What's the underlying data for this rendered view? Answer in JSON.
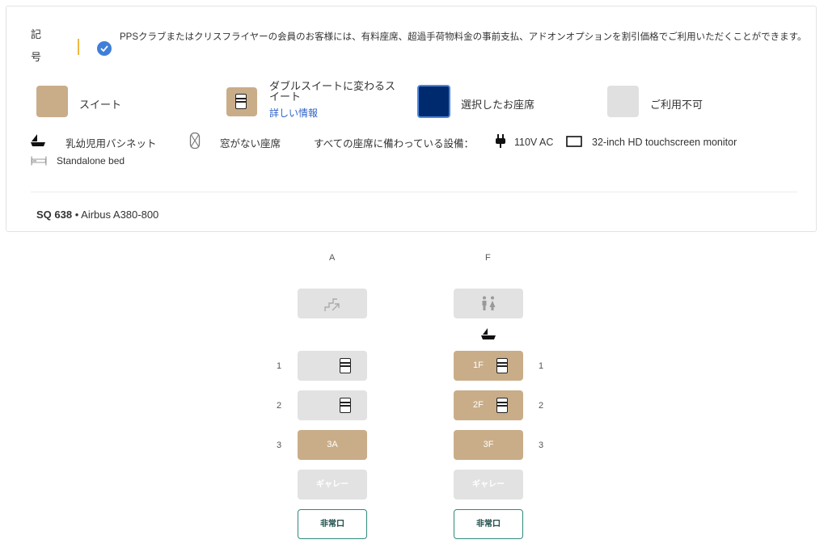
{
  "legend": {
    "key_label_line1": "記",
    "key_label_line2": "号",
    "note": "PPSクラブまたはクリスフライヤーの会員のお客様には、有料座席、超過手荷物料金の事前支払、アドオンオプションを割引価格でご利用いただくことができます。",
    "suite_label": "スイート",
    "double_suite_label": "ダブルスイートに変わるスイート",
    "double_suite_link": "詳しい情報",
    "selected_label": "選択したお座席",
    "unavailable_label": "ご利用不可",
    "bassinet_label": "乳幼児用バシネット",
    "no_window_label": "窓がない座席",
    "all_seats_amenities_label": "すべての座席に備わっている設備：",
    "power_label": "110V AC",
    "monitor_label": "32-inch HD touchscreen monitor",
    "bed_label": "Standalone bed",
    "colors": {
      "suite": "#c9ad89",
      "selected": "#002a6e",
      "unavailable": "#e0e0e0",
      "accent_blue": "#3f7fd9",
      "exit_border": "#2f8a7d"
    }
  },
  "flight": {
    "number": "SQ 638",
    "separator": " • ",
    "aircraft": "Airbus A380-800"
  },
  "seatmap": {
    "columns": [
      "A",
      "F"
    ],
    "rows": [
      "1",
      "2",
      "3"
    ],
    "stairs_icon": "stairs-icon",
    "lavatory_icon": "lavatory-icon",
    "seats": {
      "1A": "",
      "2A": "",
      "3A": "3A",
      "1F": "1F",
      "2F": "2F",
      "3F": "3F"
    },
    "galley_label": "ギャレー",
    "exit_label": "非常口"
  }
}
